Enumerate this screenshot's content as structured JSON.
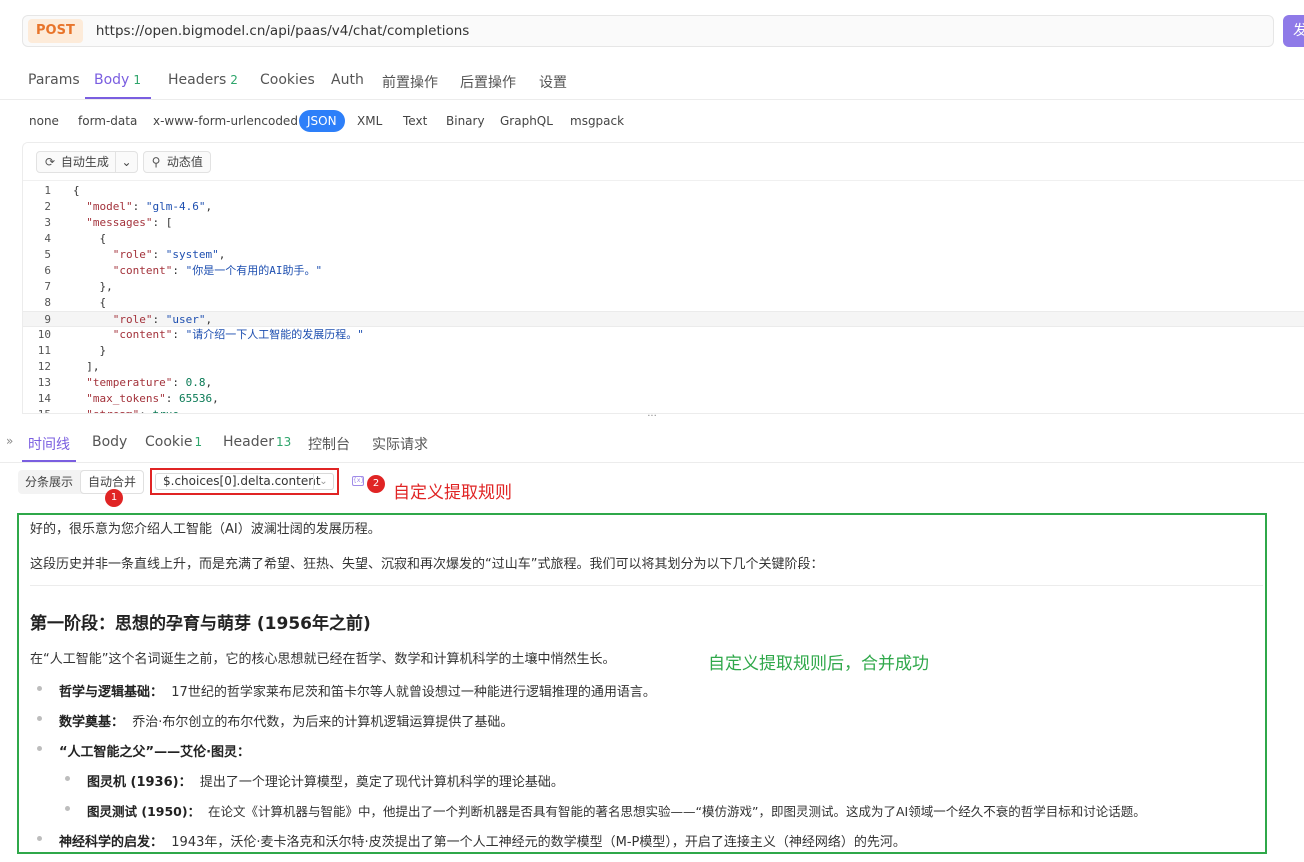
{
  "request": {
    "method": "POST",
    "url": "https://open.bigmodel.cn/api/paas/v4/chat/completions",
    "send_label": "发送"
  },
  "req_tabs": [
    {
      "label": "Params",
      "count": ""
    },
    {
      "label": "Body",
      "count": "1"
    },
    {
      "label": "Headers",
      "count": "2"
    },
    {
      "label": "Cookies",
      "count": ""
    },
    {
      "label": "Auth",
      "count": ""
    },
    {
      "label": "前置操作",
      "count": ""
    },
    {
      "label": "后置操作",
      "count": ""
    },
    {
      "label": "设置",
      "count": ""
    }
  ],
  "body_types": [
    "none",
    "form-data",
    "x-www-form-urlencoded",
    "JSON",
    "XML",
    "Text",
    "Binary",
    "GraphQL",
    "msgpack"
  ],
  "editor_toolbar": {
    "auto_generate": "自动生成",
    "dynamic_value": "动态值"
  },
  "code_lines": [
    "{",
    "  \"model\": \"glm-4.6\",",
    "  \"messages\": [",
    "    {",
    "      \"role\": \"system\",",
    "      \"content\": \"你是一个有用的AI助手。\"",
    "    },",
    "    {",
    "      \"role\": \"user\",",
    "      \"content\": \"请介绍一下人工智能的发展历程。\"",
    "    }",
    "  ],",
    "  \"temperature\": 0.8,",
    "  \"max_tokens\": 65536,",
    "  \"stream\": true"
  ],
  "resp_tabs": [
    {
      "label": "时间线",
      "count": ""
    },
    {
      "label": "Body",
      "count": ""
    },
    {
      "label": "Cookie",
      "count": "1"
    },
    {
      "label": "Header",
      "count": "13"
    },
    {
      "label": "控制台",
      "count": ""
    },
    {
      "label": "实际请求",
      "count": ""
    }
  ],
  "controls": {
    "split_view": "分条展示",
    "auto_merge": "自动合并",
    "rule_value": "$.choices[0].delta.content",
    "badge1": "1",
    "badge2": "2",
    "extract_icon": "{x}",
    "annotation_rule": "自定义提取规则"
  },
  "content": {
    "intro1": "好的，很乐意为您介绍人工智能（AI）波澜壮阔的发展历程。",
    "intro2": "这段历史并非一条直线上升，而是充满了希望、狂热、失望、沉寂和再次爆发的“过山车”式旅程。我们可以将其划分为以下几个关键阶段：",
    "section_title": "第一阶段：思想的孕育与萌芽 (1956年之前)",
    "section_intro": "在“人工智能”这个名词诞生之前，它的核心思想就已经在哲学、数学和计算机科学的土壤中悄然生长。",
    "items": [
      {
        "title": "哲学与逻辑基础：",
        "text": "17世纪的哲学家莱布尼茨和笛卡尔等人就曾设想过一种能进行逻辑推理的通用语言。"
      },
      {
        "title": "数学奠基：",
        "text": "乔治·布尔创立的布尔代数，为后来的计算机逻辑运算提供了基础。"
      },
      {
        "title": "“人工智能之父”——艾伦·图灵：",
        "text": ""
      },
      {
        "title": "图灵机 (1936)：",
        "text": "提出了一个理论计算模型，奠定了现代计算机科学的理论基础。"
      },
      {
        "title": "图灵测试 (1950)：",
        "text": "在论文《计算机器与智能》中，他提出了一个判断机器是否具有智能的著名思想实验——“模仿游戏”，即图灵测试。这成为了AI领域一个经久不衰的哲学目标和讨论话题。"
      },
      {
        "title": "神经科学的启发：",
        "text": "1943年，沃伦·麦卡洛克和沃尔特·皮茨提出了第一个人工神经元的数学模型（M-P模型），开启了连接主义（神经网络）的先河。"
      }
    ],
    "annotation_success": "自定义提取规则后，合并成功"
  },
  "colors": {
    "accent": "#7a5ee0",
    "json_pill": "#2d7ff9",
    "annotation_red": "#e02424",
    "annotation_green": "#2fa84a"
  }
}
